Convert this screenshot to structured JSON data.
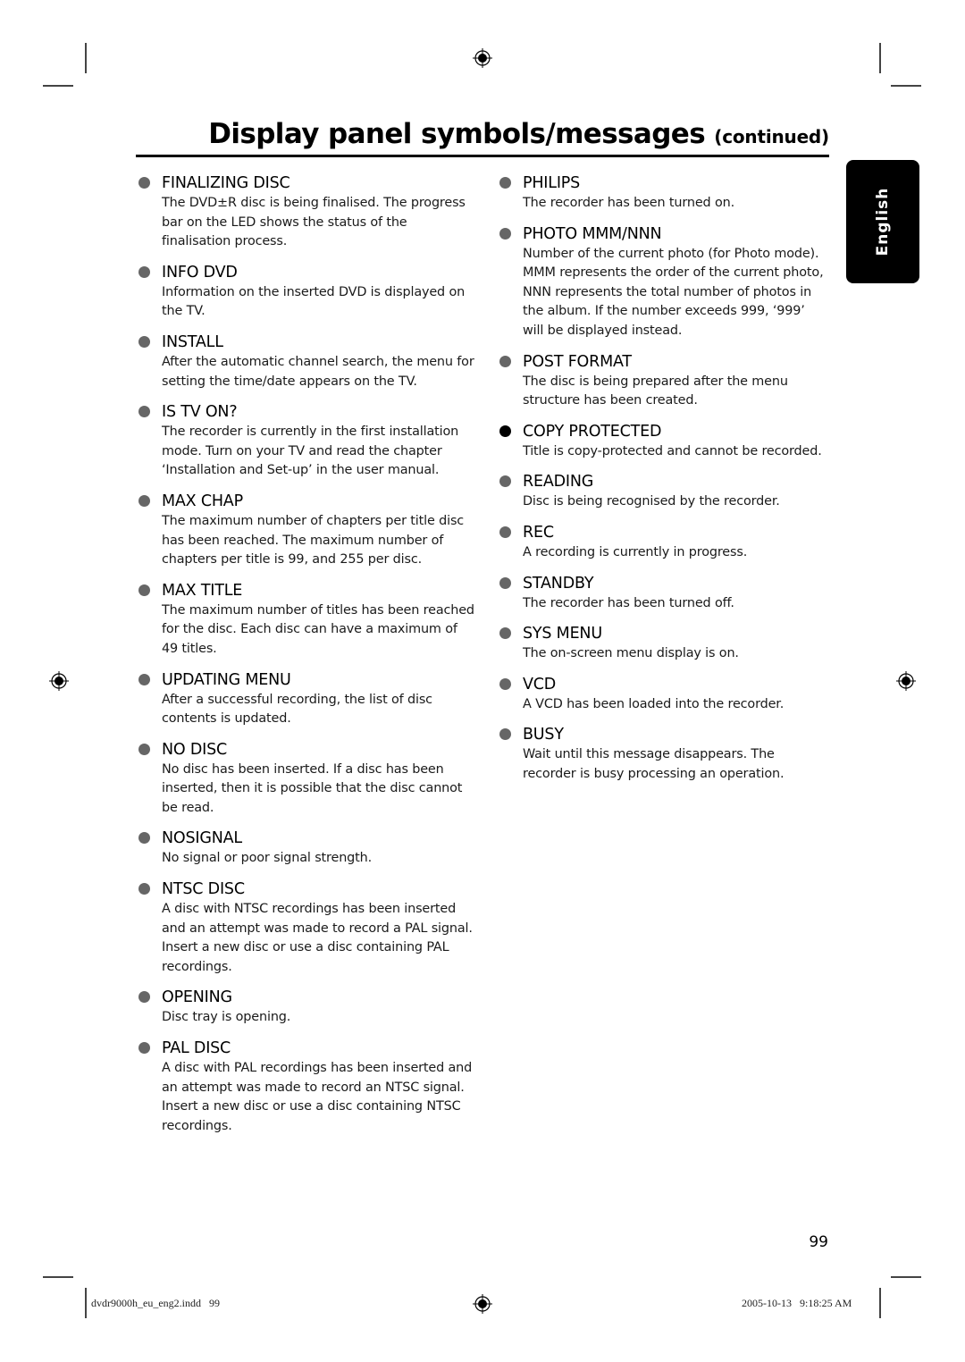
{
  "header": {
    "title": "Display panel symbols/messages",
    "title_suffix": "(continued)"
  },
  "language_tab": {
    "label": "English"
  },
  "left_column": [
    {
      "title": "FINALIZING DISC",
      "description": "The DVD±R disc is being finalised. The progress bar on the LED shows the status of the finalisation process."
    },
    {
      "title": "INFO DVD",
      "description": "Information on the inserted DVD is displayed on the TV."
    },
    {
      "title": "INSTALL",
      "description": "After the automatic channel search, the menu for setting the time/date appears on the TV."
    },
    {
      "title": "IS TV ON?",
      "description": "The recorder is currently in the first installation mode. Turn on your TV and read the chapter ‘Installation and Set-up’ in the user manual."
    },
    {
      "title": "MAX CHAP",
      "description": "The maximum number of chapters per title disc has been reached. The maximum number of chapters per title is 99, and 255 per disc."
    },
    {
      "title": "MAX TITLE",
      "description": "The maximum number of titles has been reached for the disc. Each disc can have a maximum of 49 titles."
    },
    {
      "title": "UPDATING MENU",
      "description": "After a successful recording, the list of disc contents is updated."
    },
    {
      "title": "NO DISC",
      "description": "No disc has been inserted. If a disc has been inserted, then it is possible that the disc cannot be read."
    },
    {
      "title": "NOSIGNAL",
      "description": "No signal or poor signal strength."
    },
    {
      "title": "NTSC DISC",
      "description": "A disc with NTSC recordings has been inserted and an attempt was made to record a PAL signal. Insert a new disc or use a disc containing PAL recordings."
    },
    {
      "title": "OPENING",
      "description": "Disc tray is opening."
    },
    {
      "title": "PAL DISC",
      "description": "A disc with PAL recordings has been inserted and an attempt was made to record an NTSC signal. Insert a new disc or use a disc containing NTSC recordings."
    }
  ],
  "right_column": [
    {
      "title": "PHILIPS",
      "description": "The recorder has been turned on."
    },
    {
      "title": "PHOTO MMM/NNN",
      "description": "Number of the current photo (for Photo mode). MMM represents the order of the current photo, NNN represents the total number of photos in the album. If the number exceeds 999, ‘999’ will be displayed instead."
    },
    {
      "title": "POST FORMAT",
      "description": "The disc is being prepared after the menu structure has been created."
    },
    {
      "title": "COPY PROTECTED",
      "description": "Title is copy-protected and cannot be recorded."
    },
    {
      "title": "READING",
      "description": "Disc is being recognised by the recorder."
    },
    {
      "title": "REC",
      "description": "A recording is currently in progress."
    },
    {
      "title": "STANDBY",
      "description": "The recorder has been turned off."
    },
    {
      "title": "SYS MENU",
      "description": "The on-screen menu display is on."
    },
    {
      "title": "VCD",
      "description": "A VCD has been loaded into the recorder."
    },
    {
      "title": "BUSY",
      "description": "Wait until this message disappears. The recorder is busy processing an operation."
    }
  ],
  "footer": {
    "page_number": "99",
    "file_slug": "dvdr9000h_eu_eng2.indd   99",
    "timestamp": "2005-10-13   9:18:25 AM"
  },
  "colors": {
    "bullet": "#666666",
    "bullet_dark": "#000000",
    "language_tab_bg": "#000000",
    "language_tab_text": "#ffffff"
  }
}
